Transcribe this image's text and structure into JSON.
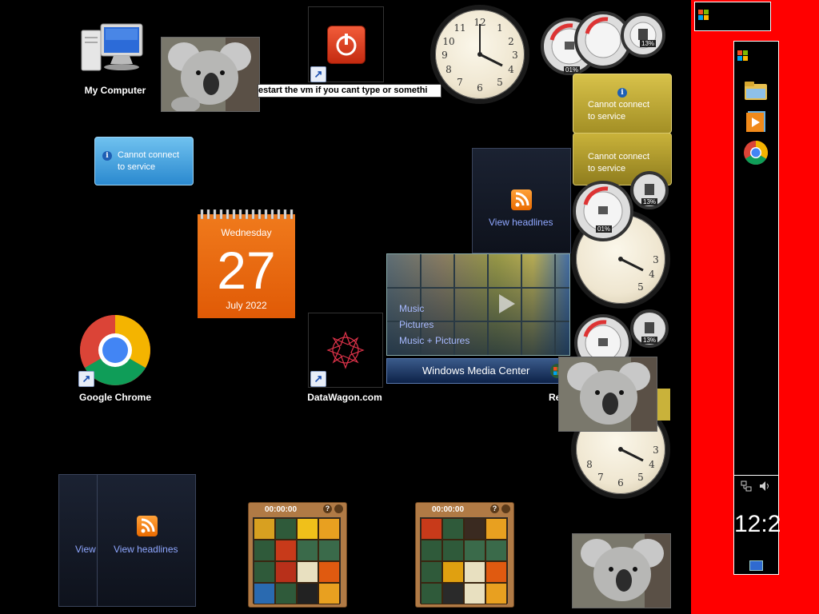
{
  "desktop": {
    "icons": {
      "my_computer": "My Computer",
      "google_chrome": "Google Chrome",
      "datawagon": "DataWagon.com",
      "partial_label": "Re"
    },
    "rename_text": "estart the vm if you cant type or somethi"
  },
  "gadgets": {
    "info_message": "Cannot connect to service",
    "info_line1": "Cannot connect",
    "info_line2": "to service",
    "feed_headlines": "View headlines",
    "feed_partial": "View",
    "calendar": {
      "weekday": "Wednesday",
      "day": "27",
      "month_year": "July 2022"
    },
    "media_center": {
      "menu_items": [
        "Music",
        "Pictures",
        "Music + Pictures"
      ],
      "brand": "Windows Media Center"
    },
    "meter": {
      "cpu_label": "01%",
      "mem_label": "13%"
    },
    "puzzle": {
      "timer": "00:00:00"
    }
  },
  "sidebar": {
    "clock_text": "12:2",
    "icons": [
      "windows-logo-icon",
      "folder-icon",
      "media-player-icon",
      "chrome-icon",
      "network-icon",
      "volume-icon",
      "show-desktop-icon"
    ]
  },
  "colors": {
    "desktop_bg": "#000000",
    "sidebar_bg": "#ff0000",
    "calendar_orange": "#e8680e",
    "feed_link": "#8fa7ff",
    "info_gadget_blue": "#3f9ad6",
    "info_gadget_gold": "#c9b23a"
  }
}
